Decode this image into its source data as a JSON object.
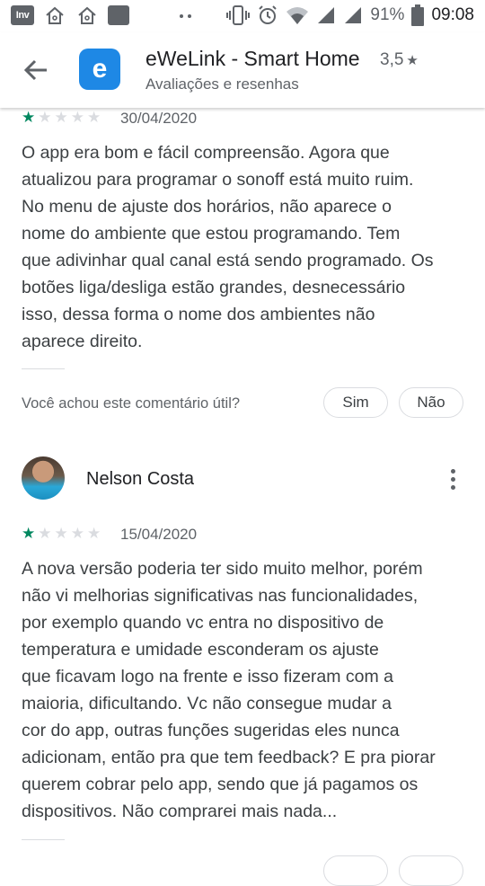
{
  "status_bar": {
    "inv_icon_label": "Inv",
    "battery_percent": "91%",
    "time": "09:08"
  },
  "header": {
    "app_title": "eWeLink - Smart Home",
    "app_rating": "3,5",
    "subtitle": "Avaliações e resenhas",
    "app_icon_letter": "e"
  },
  "reviews": [
    {
      "stars": 1,
      "date": "30/04/2020",
      "text": "O app era bom e fácil compreensão. Agora que\natualizou para programar o sonoff está muito ruim.\nNo menu de ajuste dos horários, não aparece o\nnome do ambiente que estou programando. Tem\nque adivinhar qual canal está sendo programado. Os\nbotões liga/desliga estão grandes, desnecessário\nisso, dessa forma o nome dos ambientes não\naparece direito.",
      "helpful_question": "Você achou este comentário útil?",
      "yes_label": "Sim",
      "no_label": "Não"
    },
    {
      "author": "Nelson Costa",
      "stars": 1,
      "date": "15/04/2020",
      "text": "A nova versão poderia ter sido muito melhor, porém\nnão vi melhorias significativas nas funcionalidades,\npor exemplo quando vc entra no dispositivo de\ntemperatura e umidade esconderam os ajuste\nque ficavam logo na frente e isso fizeram com a\nmaioria, dificultando. Vc não consegue mudar a\ncor do app, outras funções sugeridas eles nunca\nadicionam, então pra que tem feedback? E pra piorar\nquerem cobrar pelo app, sendo que já pagamos os\ndispositivos. Não comprarei mais nada..."
    }
  ],
  "colors": {
    "star_filled": "#01875f",
    "star_empty": "#dadce0",
    "app_icon_bg": "#1e88e5"
  }
}
